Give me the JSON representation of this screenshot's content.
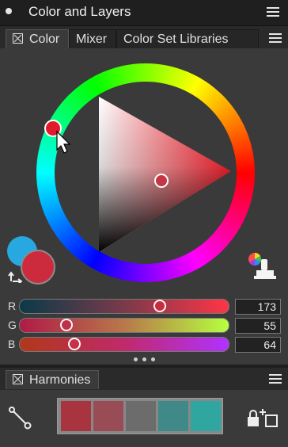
{
  "window": {
    "title": "Color and Layers"
  },
  "tabs": [
    {
      "label": "Color",
      "active": true
    },
    {
      "label": "Mixer",
      "active": false
    },
    {
      "label": "Color Set Libraries",
      "active": false
    }
  ],
  "colors": {
    "main": "#cc2b3d",
    "sub": "#28a8e0",
    "hue_handle": "#e01a2a",
    "accent_triangle": "#ff1f2c"
  },
  "sliders": {
    "r": {
      "label": "R",
      "value": "173",
      "level": 0.678
    },
    "g": {
      "label": "G",
      "value": "55",
      "level": 0.216
    },
    "b": {
      "label": "B",
      "value": "64",
      "level": 0.251
    }
  },
  "harmonies": {
    "tab_label": "Harmonies",
    "swatches": [
      "#a8343f",
      "#9a4c56",
      "#6c6c6c",
      "#3f8a88",
      "#2fa6a0"
    ]
  },
  "icons": [
    "menu-icon",
    "swap-colors-icon",
    "color-picker-stamp-icon",
    "harmony-node-icon",
    "lock-add-icon",
    "more-dots-icon"
  ]
}
